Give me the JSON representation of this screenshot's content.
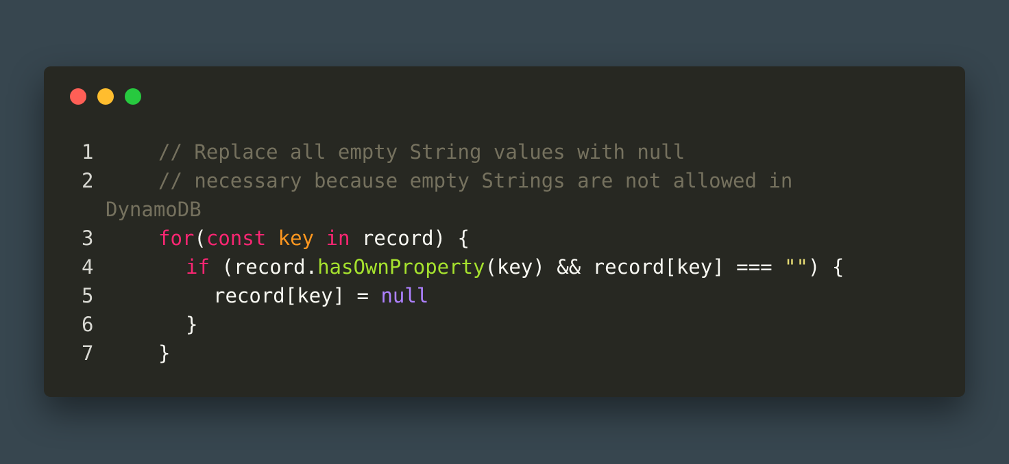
{
  "window": {
    "controls": [
      {
        "name": "close",
        "color": "#ff5f56"
      },
      {
        "name": "minimize",
        "color": "#ffbd2e"
      },
      {
        "name": "maximize",
        "color": "#27c93f"
      }
    ]
  },
  "code": {
    "lines": [
      {
        "number": "1",
        "indent": 0,
        "tokens": [
          {
            "type": "comment",
            "text": "// Replace all empty String values with null"
          }
        ]
      },
      {
        "number": "2",
        "indent": 0,
        "tokens": [
          {
            "type": "comment",
            "text": "// necessary because empty Strings are not allowed in"
          }
        ],
        "wrap": "DynamoDB"
      },
      {
        "number": "3",
        "indent": 0,
        "tokens": [
          {
            "type": "keyword",
            "text": "for"
          },
          {
            "type": "plain",
            "text": "("
          },
          {
            "type": "storage",
            "text": "const"
          },
          {
            "type": "plain",
            "text": " "
          },
          {
            "type": "var",
            "text": "key"
          },
          {
            "type": "plain",
            "text": " "
          },
          {
            "type": "keyword",
            "text": "in"
          },
          {
            "type": "plain",
            "text": " record) {"
          }
        ]
      },
      {
        "number": "4",
        "indent": 1,
        "tokens": [
          {
            "type": "keyword",
            "text": "if"
          },
          {
            "type": "plain",
            "text": " (record."
          },
          {
            "type": "func",
            "text": "hasOwnProperty"
          },
          {
            "type": "plain",
            "text": "(key) && record[key] === "
          },
          {
            "type": "string",
            "text": "\"\""
          },
          {
            "type": "plain",
            "text": ") {"
          }
        ]
      },
      {
        "number": "5",
        "indent": 2,
        "tokens": [
          {
            "type": "plain",
            "text": "record[key] = "
          },
          {
            "type": "const",
            "text": "null"
          }
        ]
      },
      {
        "number": "6",
        "indent": 1,
        "tokens": [
          {
            "type": "plain",
            "text": "}"
          }
        ]
      },
      {
        "number": "7",
        "indent": 0,
        "tokens": [
          {
            "type": "plain",
            "text": "}"
          }
        ]
      }
    ]
  }
}
